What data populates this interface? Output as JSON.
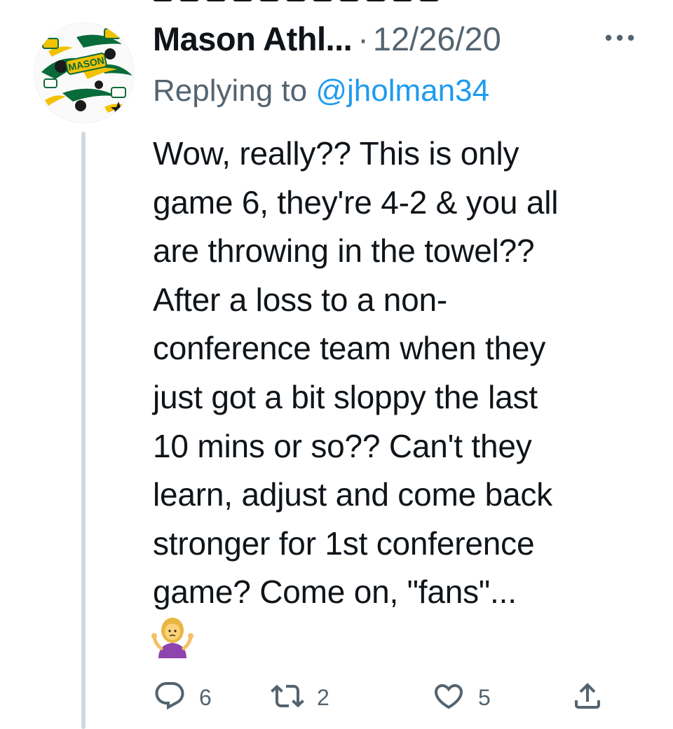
{
  "tweet": {
    "author_name": "Mason Athl...",
    "separator": "·",
    "date": "12/26/20",
    "reply_prefix": "Replying to ",
    "reply_handle": "@jholman34",
    "text": "Wow, really?? This is only\ngame 6, they're 4-2 & you all\nare throwing in the towel??\nAfter a loss to a non-\nconference team when they\njust got a bit sloppy the last\n10 mins or so?? Can't they\nlearn, adjust and come back\nstronger for 1st conference\ngame? Come on, \"fans\"...",
    "emoji": "person-shrugging-emoji",
    "avatar_logo_text": "MASON"
  },
  "actions": {
    "reply_count": "6",
    "retweet_count": "2",
    "like_count": "5"
  },
  "icons": {
    "reply": "reply-icon",
    "retweet": "retweet-icon",
    "like": "heart-icon",
    "share": "share-icon",
    "more": "more-icon"
  },
  "colors": {
    "text": "#0f1419",
    "secondary": "#536471",
    "link": "#1d9bf0",
    "thread_line": "#cfd9de",
    "mason_green": "#006633",
    "mason_gold": "#ffcc33"
  }
}
